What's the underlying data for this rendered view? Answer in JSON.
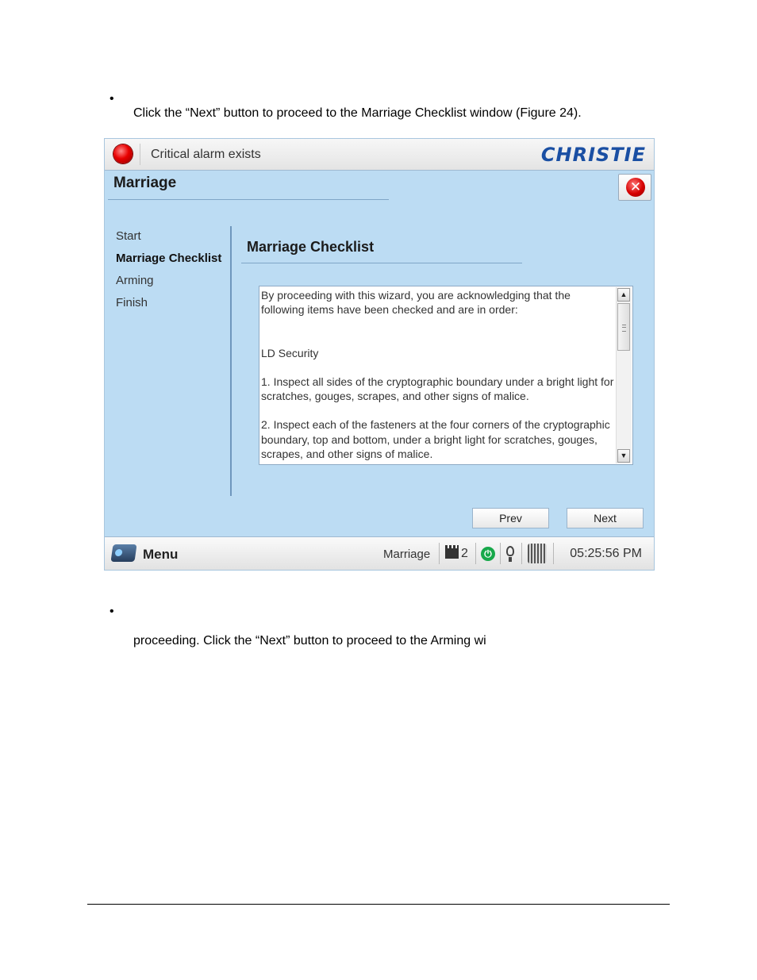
{
  "doc": {
    "line1": "Click the “Next” button to proceed to the Marriage Checklist window (Figure 24).",
    "line2": "proceeding. Click the “Next” button to proceed to the Arming wi",
    "bullet": "•"
  },
  "app": {
    "alarm_text": "Critical alarm exists",
    "logo": "CHRISTIE",
    "window_title": "Marriage",
    "close_glyph": "✕",
    "nav": [
      "Start",
      "Marriage Checklist",
      "Arming",
      "Finish"
    ],
    "section_title": "Marriage Checklist",
    "checklist": {
      "intro": "By proceeding with this wizard, you are acknowledging that the following items have been checked and are in order:",
      "heading": "LD Security",
      "item1": "1. Inspect all sides of the cryptographic boundary under a bright light for scratches, gouges, scrapes, and other signs of malice.",
      "item2": "2. Inspect each of the fasteners at the four corners of the cryptographic boundary, top and bottom, under a bright light for scratches, gouges, scrapes, and other signs of malice."
    },
    "buttons": {
      "prev": "Prev",
      "next": "Next"
    },
    "status": {
      "menu": "Menu",
      "mode": "Marriage",
      "count": "2",
      "time": "05:25:56 PM"
    }
  }
}
